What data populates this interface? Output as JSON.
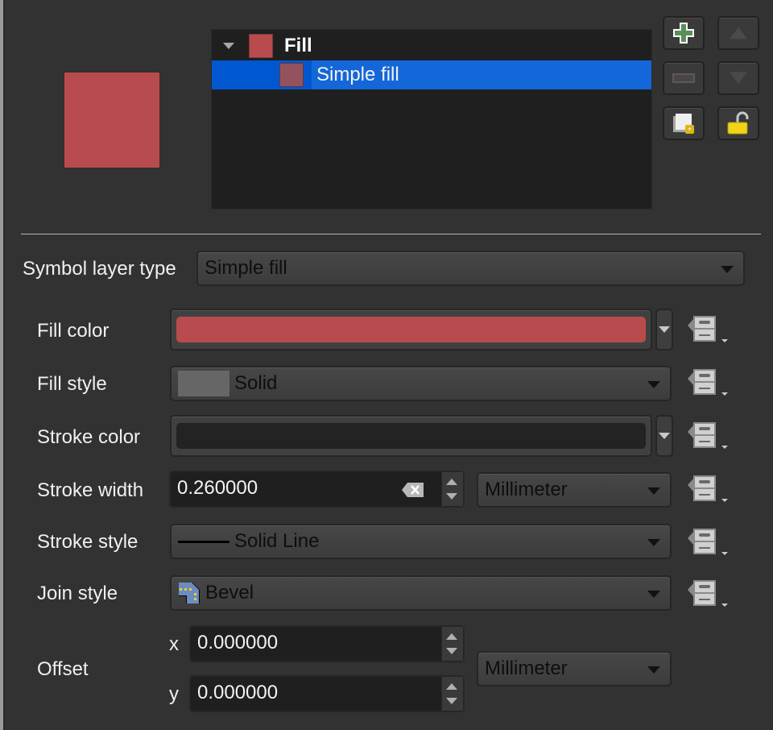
{
  "preview": {
    "color": "#b84b4e"
  },
  "layer_tree": {
    "items": [
      {
        "label": "Fill",
        "color": "#b84b4e",
        "expanded": true,
        "selected": false
      },
      {
        "label": "Simple fill",
        "color": "#93525e",
        "selected": true
      }
    ]
  },
  "toolbar": {
    "buttons": [
      {
        "name": "add-layer",
        "icon": "plus-icon",
        "enabled": true
      },
      {
        "name": "move-up",
        "icon": "arrow-up-icon",
        "enabled": false
      },
      {
        "name": "remove-layer",
        "icon": "minus-icon",
        "enabled": false
      },
      {
        "name": "move-down",
        "icon": "arrow-down-icon",
        "enabled": false
      },
      {
        "name": "duplicate-layer",
        "icon": "duplicate-icon",
        "enabled": true
      },
      {
        "name": "lock-layer",
        "icon": "unlock-icon",
        "enabled": true
      }
    ]
  },
  "symbol_layer_type": {
    "label": "Symbol layer type",
    "value": "Simple fill"
  },
  "properties": {
    "fill_color": {
      "label": "Fill color",
      "color": "#b84b4e"
    },
    "fill_style": {
      "label": "Fill style",
      "value": "Solid"
    },
    "stroke_color": {
      "label": "Stroke color",
      "color": "#232323"
    },
    "stroke_width": {
      "label": "Stroke width",
      "value": "0.260000",
      "unit": "Millimeter"
    },
    "stroke_style": {
      "label": "Stroke style",
      "value": "Solid Line"
    },
    "join_style": {
      "label": "Join style",
      "value": "Bevel"
    },
    "offset": {
      "label": "Offset",
      "x_label": "x",
      "x": "0.000000",
      "y_label": "y",
      "y": "0.000000",
      "unit": "Millimeter"
    }
  }
}
